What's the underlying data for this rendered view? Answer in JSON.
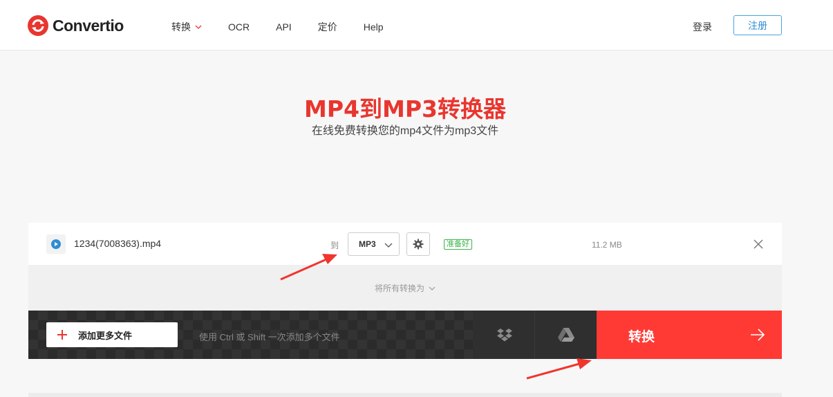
{
  "header": {
    "logo_text": "Convertio",
    "nav": [
      {
        "label": "转换"
      },
      {
        "label": "OCR"
      },
      {
        "label": "API"
      },
      {
        "label": "定价"
      },
      {
        "label": "Help"
      }
    ],
    "login_label": "登录",
    "signup_label": "注册"
  },
  "hero": {
    "title": "MP4到MP3转换器",
    "subtitle": "在线免费转换您的mp4文件为mp3文件"
  },
  "file": {
    "name": "1234(7008363).mp4",
    "to_label": "到",
    "format": "MP3",
    "status": "准备好",
    "size": "11.2 MB"
  },
  "convert_all_label": "将所有转换为",
  "actions": {
    "add_label": "添加更多文件",
    "hint": "使用 Ctrl 或 Shift 一次添加多个文件",
    "convert_label": "转换"
  },
  "colors": {
    "brand_red": "#ff3a35",
    "title_red": "#e8362f",
    "ready_green": "#3bb34a",
    "signup_blue": "#2f8ed2"
  },
  "icons": [
    "convertio-logo-icon",
    "chevron-down-icon",
    "play-icon",
    "gear-icon",
    "close-icon",
    "plus-icon",
    "dropbox-icon",
    "google-drive-icon",
    "arrow-right-icon"
  ]
}
